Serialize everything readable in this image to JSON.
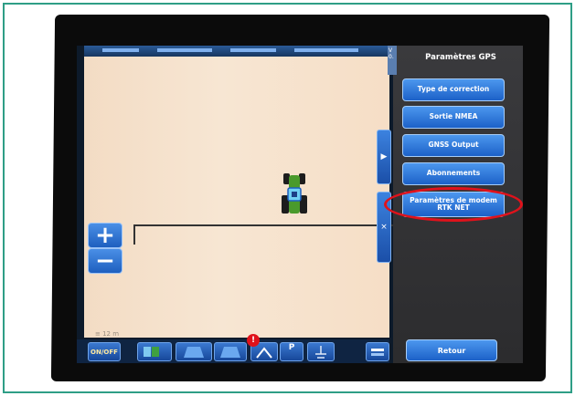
{
  "panel": {
    "title": "Paramètres GPS",
    "menu_items": [
      {
        "label": "Type de correction"
      },
      {
        "label": "Sortie NMEA"
      },
      {
        "label": "GNSS Output"
      },
      {
        "label": "Abonnements"
      },
      {
        "label": "Paramètres de modem RTK NET"
      }
    ],
    "back_label": "Retour",
    "strip_text": "V\n0."
  },
  "map": {
    "scale_label": "≡ 12 m",
    "zoom_in": "+",
    "zoom_out": "−"
  },
  "bottom_bar": {
    "on_label": "ON/OFF",
    "p_label": "P",
    "alert_badge": "!"
  },
  "side_tabs": {
    "expand": "▶",
    "close": "×"
  },
  "colors": {
    "button_blue": "#1c61c8",
    "highlight_red": "#e0121b",
    "frame_teal": "#2e9e86"
  }
}
